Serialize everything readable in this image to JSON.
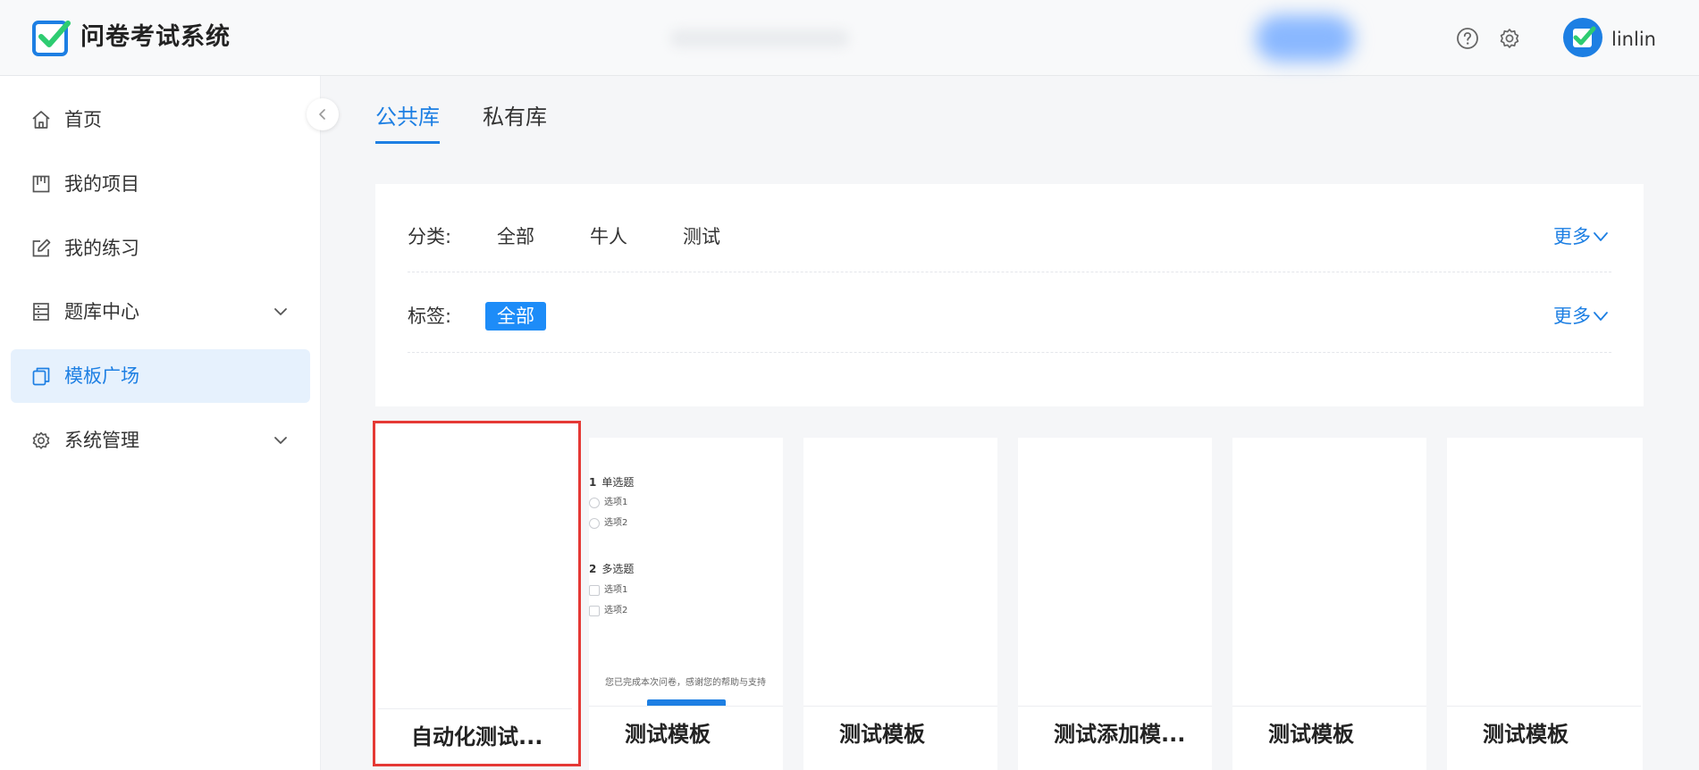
{
  "header": {
    "app_title": "问卷考试系统",
    "username": "linlin",
    "help_icon": "help-circle-icon",
    "settings_icon": "gear-icon",
    "brand_color": "#1d7fe3",
    "logo_check_color": "#2ecc71"
  },
  "sidebar": {
    "items": [
      {
        "label": "首页",
        "icon": "home-icon"
      },
      {
        "label": "我的项目",
        "icon": "project-icon"
      },
      {
        "label": "我的练习",
        "icon": "edit-icon"
      },
      {
        "label": "题库中心",
        "icon": "question-bank-icon"
      },
      {
        "label": "模板广场",
        "icon": "template-icon"
      },
      {
        "label": "系统管理",
        "icon": "gear-icon"
      }
    ],
    "active_item": "模板广场",
    "expandable_items": [
      "题库中心",
      "系统管理"
    ]
  },
  "tabs": [
    {
      "label": "公共库",
      "active": true
    },
    {
      "label": "私有库",
      "active": false
    }
  ],
  "filters": {
    "category_label": "分类:",
    "categories": [
      "全部",
      "牛人",
      "测试"
    ],
    "tag_label": "标签:",
    "tags": [
      "全部"
    ],
    "selected_tag": "全部",
    "more_label": "更多"
  },
  "templates": [
    {
      "title": "自动化测试...",
      "selected": true,
      "has_preview": false
    },
    {
      "title": "测试模板",
      "selected": false,
      "has_preview": true
    },
    {
      "title": "测试模板",
      "selected": false,
      "has_preview": false
    },
    {
      "title": "测试添加模...",
      "selected": false,
      "has_preview": false
    },
    {
      "title": "测试模板",
      "selected": false,
      "has_preview": false
    },
    {
      "title": "测试模板",
      "selected": false,
      "has_preview": false
    }
  ],
  "preview": {
    "q1_number": "1",
    "q1_title": "单选题",
    "q1_options": [
      "选项1",
      "选项2"
    ],
    "q2_number": "2",
    "q2_title": "多选题",
    "q2_options": [
      "选项1",
      "选项2"
    ],
    "thanks_text": "您已完成本次问卷，感谢您的帮助与支持"
  }
}
